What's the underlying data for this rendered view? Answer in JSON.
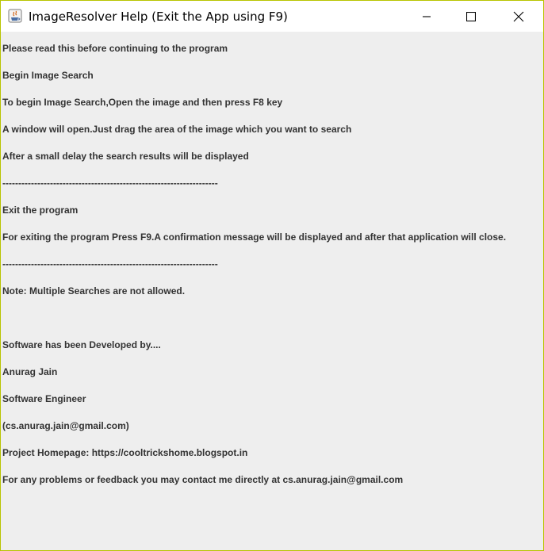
{
  "window": {
    "title": "ImageResolver Help (Exit the App using F9)",
    "icon": "java-app-icon",
    "controls": [
      "minimize-icon",
      "maximize-icon",
      "close-icon"
    ],
    "border_color": "#b8c400"
  },
  "content": {
    "lines": [
      "Please read this before continuing to the program",
      "Begin Image Search",
      "To begin Image Search,Open the image and then press F8 key",
      "A window will open.Just drag the area of the image which you want to search",
      "After a small delay the search results will be displayed",
      "--------------------------------------------------------------------",
      "Exit the program",
      "For exiting the program Press F9.A confirmation message will be displayed and after that application will close.",
      "--------------------------------------------------------------------",
      "Note: Multiple Searches are not allowed.",
      "Software has been Developed by....",
      "Anurag Jain",
      "Software Engineer",
      "(cs.anurag.jain@gmail.com)",
      "Project Homepage: https://cooltrickshome.blogspot.in",
      "For any problems or feedback you may contact me directly at cs.anurag.jain@gmail.com"
    ]
  }
}
